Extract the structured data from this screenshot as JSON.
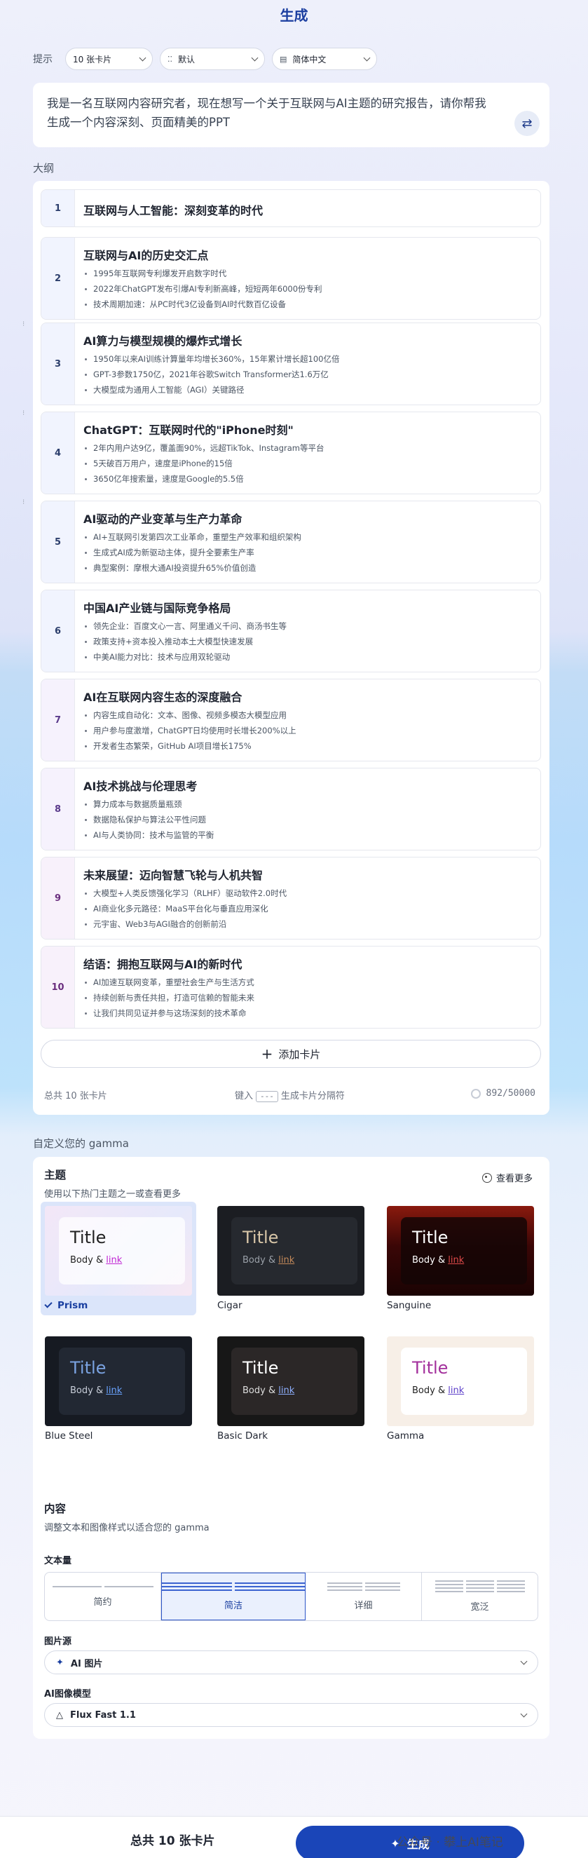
{
  "header": {
    "title": "生成"
  },
  "toolbar": {
    "label": "提示",
    "card_count": "10 张卡片",
    "layout_icon": "layout-icon",
    "layout": "默认",
    "language_icon": "language-icon",
    "language": "简体中文"
  },
  "prompt": {
    "text": "我是一名互联网内容研究者，现在想写一个关于互联网与AI主题的研究报告，请你帮我生成一个内容深刻、页面精美的PPT"
  },
  "outline": {
    "label": "大纲",
    "cards": [
      {
        "num": "1",
        "title": "互联网与人工智能：深刻变革的时代",
        "bullets": []
      },
      {
        "num": "2",
        "title": "互联网与AI的历史交汇点",
        "bullets": [
          "1995年互联网专利爆发开启数字时代",
          "2022年ChatGPT发布引爆AI专利新高峰，短短两年6000份专利",
          "技术周期加速：从PC时代3亿设备到AI时代数百亿设备"
        ]
      },
      {
        "num": "3",
        "title": "AI算力与模型规模的爆炸式增长",
        "bullets": [
          "1950年以来AI训练计算量年均增长360%，15年累计增长超100亿倍",
          "GPT-3参数1750亿，2021年谷歌Switch Transformer达1.6万亿",
          "大模型成为通用人工智能（AGI）关键路径"
        ]
      },
      {
        "num": "4",
        "title": "ChatGPT：互联网时代的\"iPhone时刻\"",
        "bullets": [
          "2年内用户达9亿，覆盖面90%，远超TikTok、Instagram等平台",
          "5天破百万用户，速度是iPhone的15倍",
          "3650亿年搜索量，速度是Google的5.5倍"
        ]
      },
      {
        "num": "5",
        "title": "AI驱动的产业变革与生产力革命",
        "bullets": [
          "AI+互联网引发第四次工业革命，重塑生产效率和组织架构",
          "生成式AI成为新驱动主体，提升全要素生产率",
          "典型案例：摩根大通AI投资提升65%价值创造"
        ]
      },
      {
        "num": "6",
        "title": "中国AI产业链与国际竞争格局",
        "bullets": [
          "领先企业：百度文心一言、阿里通义千问、商汤书生等",
          "政策支持+资本投入推动本土大模型快速发展",
          "中美AI能力对比：技术与应用双轮驱动"
        ]
      },
      {
        "num": "7",
        "title": "AI在互联网内容生态的深度融合",
        "bullets": [
          "内容生成自动化：文本、图像、视频多模态大模型应用",
          "用户参与度激增，ChatGPT日均使用时长增长200%以上",
          "开发者生态繁荣，GitHub AI项目增长175%"
        ]
      },
      {
        "num": "8",
        "title": "AI技术挑战与伦理思考",
        "bullets": [
          "算力成本与数据质量瓶颈",
          "数据隐私保护与算法公平性问题",
          "AI与人类协同：技术与监管的平衡"
        ]
      },
      {
        "num": "9",
        "title": "未来展望：迈向智慧飞轮与人机共智",
        "bullets": [
          "大模型+人类反馈强化学习（RLHF）驱动软件2.0时代",
          "AI商业化多元路径：MaaS平台化与垂直应用深化",
          "元宇宙、Web3与AGI融合的创新前沿"
        ]
      },
      {
        "num": "10",
        "title": "结语：拥抱互联网与AI的新时代",
        "bullets": [
          "AI加速互联网变革，重塑社会生产与生活方式",
          "持续创新与责任共担，打造可信赖的智能未来",
          "让我们共同见证并参与这场深刻的技术革命"
        ]
      }
    ],
    "add_card_label": "添加卡片",
    "footer": {
      "total": "总共 10 张卡片",
      "hint_prefix": "键入",
      "hint_key": "---",
      "hint_suffix": "生成卡片分隔符",
      "char_count": "892/50000"
    }
  },
  "customize": {
    "label": "自定义您的 gamma",
    "theme_heading": "主题",
    "theme_sub": "使用以下热门主题之一或查看更多",
    "see_more": "查看更多",
    "themes": [
      {
        "name": "Prism",
        "title": "Title",
        "body": "Body & ",
        "link": "link",
        "selected": true
      },
      {
        "name": "Cigar",
        "title": "Title",
        "body": "Body & ",
        "link": "link"
      },
      {
        "name": "Sanguine",
        "title": "Title",
        "body": "Body & ",
        "link": "link"
      },
      {
        "name": "Blue Steel",
        "title": "Title",
        "body": "Body & ",
        "link": "link"
      },
      {
        "name": "Basic Dark",
        "title": "Title",
        "body": "Body & ",
        "link": "link"
      },
      {
        "name": "Gamma",
        "title": "Title",
        "body": "Body & ",
        "link": "link"
      }
    ],
    "content_heading": "内容",
    "content_sub": "调整文本和图像样式以适合您的 gamma",
    "text_amount_label": "文本量",
    "text_amounts": [
      "简约",
      "简洁",
      "详细",
      "宽泛"
    ],
    "text_amount_selected": "简洁",
    "image_source_label": "图片源",
    "image_source": "AI 图片",
    "image_model_label": "AI图像模型",
    "image_model": "Flux Fast 1.1"
  },
  "footer": {
    "total": "总共 10 张卡片",
    "generate": "生成",
    "watermark": "公众号 · 攀上AI笔记"
  },
  "colors": {
    "accent": "#1a45b8",
    "title": "#1b3ea0"
  }
}
